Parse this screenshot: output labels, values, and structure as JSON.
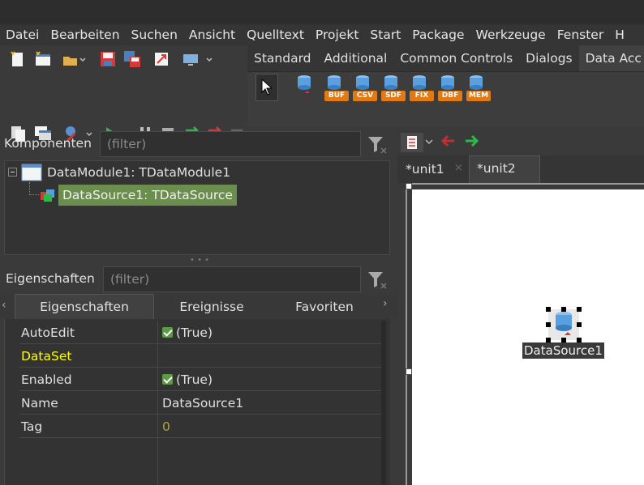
{
  "menu": [
    "Datei",
    "Bearbeiten",
    "Suchen",
    "Ansicht",
    "Quelltext",
    "Projekt",
    "Start",
    "Package",
    "Werkzeuge",
    "Fenster",
    "H"
  ],
  "palette": {
    "tabs": [
      "Standard",
      "Additional",
      "Common Controls",
      "Dialogs",
      "Data Acc"
    ],
    "active_tab": "Data Acc",
    "components": [
      {
        "name": "datasource-component",
        "tag": ""
      },
      {
        "name": "bufdataset-component",
        "tag": "BUF"
      },
      {
        "name": "csvdataset-component",
        "tag": "CSV"
      },
      {
        "name": "sdfdataset-component",
        "tag": "SDF"
      },
      {
        "name": "fixedformat-component",
        "tag": "FIX"
      },
      {
        "name": "dbf-component",
        "tag": "DBF"
      },
      {
        "name": "memdataset-component",
        "tag": "MEM"
      }
    ]
  },
  "components_panel": {
    "label": "Komponenten",
    "filter_placeholder": "(filter)",
    "tree": [
      {
        "label": "DataModule1: TDataModule1"
      },
      {
        "label": "DataSource1: TDataSource"
      }
    ]
  },
  "properties_panel": {
    "label": "Eigenschaften",
    "filter_placeholder": "(filter)",
    "tabs": [
      "Eigenschaften",
      "Ereignisse",
      "Favoriten"
    ],
    "rows": [
      {
        "key": "AutoEdit",
        "value": "(True)",
        "checkbox": true
      },
      {
        "key": "DataSet",
        "value": ""
      },
      {
        "key": "Enabled",
        "value": "(True)",
        "checkbox": true
      },
      {
        "key": "Name",
        "value": "DataSource1"
      },
      {
        "key": "Tag",
        "value": "0"
      }
    ]
  },
  "editor_tabs": [
    "*unit1",
    "*unit2"
  ],
  "designer": {
    "component_label": "DataSource1"
  },
  "colors": {
    "highlight_key": "#ffff00",
    "tag_value": "#b5a23a",
    "tree_selection": "#6b8e4e"
  }
}
